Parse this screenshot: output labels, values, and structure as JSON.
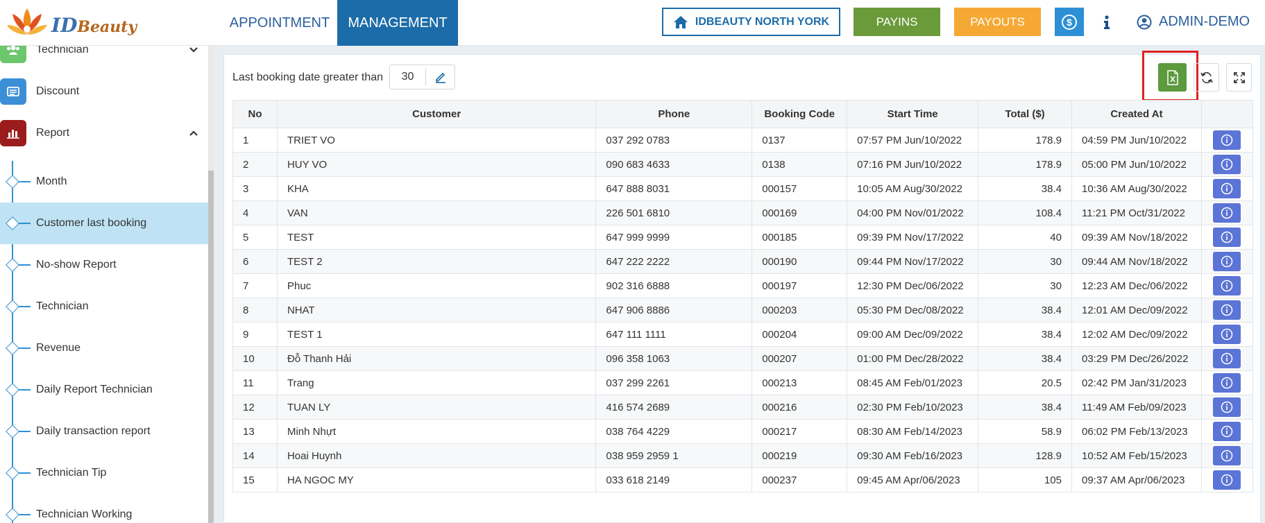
{
  "header": {
    "logo_id": "ID",
    "logo_text": "Beauty",
    "tabs": [
      {
        "label": "APPOINTMENT",
        "active": false
      },
      {
        "label": "MANAGEMENT",
        "active": true
      }
    ],
    "store_label": "IDBEAUTY NORTH YORK",
    "payins_label": "PAYINS",
    "payouts_label": "PAYOUTS",
    "user_label": "ADMIN-DEMO",
    "colors": {
      "brand": "#1b6ca8",
      "payins": "#6a9a3a",
      "payouts": "#f5a833",
      "dollar": "#2d8fd5"
    }
  },
  "sidebar": {
    "menu": [
      {
        "label": "Technician",
        "icon": "users-icon",
        "color": "#6cc66c",
        "expanded": false
      },
      {
        "label": "Discount",
        "icon": "discount-icon",
        "color": "#3c8fd6",
        "expanded": false
      },
      {
        "label": "Report",
        "icon": "bar-chart-icon",
        "color": "#9b1c1c",
        "expanded": true
      }
    ],
    "sub_items": [
      {
        "label": "Month",
        "active": false
      },
      {
        "label": "Customer last booking",
        "active": true
      },
      {
        "label": "No-show Report",
        "active": false
      },
      {
        "label": "Technician",
        "active": false
      },
      {
        "label": "Revenue",
        "active": false
      },
      {
        "label": "Daily Report Technician",
        "active": false
      },
      {
        "label": "Daily transaction report",
        "active": false
      },
      {
        "label": "Technician Tip",
        "active": false
      },
      {
        "label": "Technician Working",
        "active": false
      }
    ]
  },
  "filter": {
    "label": "Last booking date greater than",
    "value": "30"
  },
  "table": {
    "columns": [
      "No",
      "Customer",
      "Phone",
      "Booking Code",
      "Start Time",
      "Total ($)",
      "Created At",
      ""
    ],
    "rows": [
      [
        "1",
        "TRIET VO",
        "037 292 0783",
        "0137",
        "07:57 PM Jun/10/2022",
        "178.9",
        "04:59 PM Jun/10/2022"
      ],
      [
        "2",
        "HUY VO",
        "090 683 4633",
        "0138",
        "07:16 PM Jun/10/2022",
        "178.9",
        "05:00 PM Jun/10/2022"
      ],
      [
        "3",
        "KHA",
        "647 888 8031",
        "000157",
        "10:05 AM Aug/30/2022",
        "38.4",
        "10:36 AM Aug/30/2022"
      ],
      [
        "4",
        "VAN",
        "226 501 6810",
        "000169",
        "04:00 PM Nov/01/2022",
        "108.4",
        "11:21 PM Oct/31/2022"
      ],
      [
        "5",
        "TEST",
        "647 999 9999",
        "000185",
        "09:39 PM Nov/17/2022",
        "40",
        "09:39 AM Nov/18/2022"
      ],
      [
        "6",
        "TEST 2",
        "647 222 2222",
        "000190",
        "09:44 PM Nov/17/2022",
        "30",
        "09:44 AM Nov/18/2022"
      ],
      [
        "7",
        "Phuc",
        "902 316 6888",
        "000197",
        "12:30 PM Dec/06/2022",
        "30",
        "12:23 AM Dec/06/2022"
      ],
      [
        "8",
        "NHAT",
        "647 906 8886",
        "000203",
        "05:30 PM Dec/08/2022",
        "38.4",
        "12:01 AM Dec/09/2022"
      ],
      [
        "9",
        "TEST 1",
        "647 111 1111",
        "000204",
        "09:00 AM Dec/09/2022",
        "38.4",
        "12:02 AM Dec/09/2022"
      ],
      [
        "10",
        "Đỗ Thanh Hải",
        "096 358 1063",
        "000207",
        "01:00 PM Dec/28/2022",
        "38.4",
        "03:29 PM Dec/26/2022"
      ],
      [
        "11",
        "Trang",
        "037 299 2261",
        "000213",
        "08:45 AM Feb/01/2023",
        "20.5",
        "02:42 PM Jan/31/2023"
      ],
      [
        "12",
        "TUAN LY",
        "416 574 2689",
        "000216",
        "02:30 PM Feb/10/2023",
        "38.4",
        "11:49 AM Feb/09/2023"
      ],
      [
        "13",
        "Minh Nhựt",
        "038 764 4229",
        "000217",
        "08:30 AM Feb/14/2023",
        "58.9",
        "06:02 PM Feb/13/2023"
      ],
      [
        "14",
        "Hoai Huynh",
        "038 959 2959 1",
        "000219",
        "09:30 AM Feb/16/2023",
        "128.9",
        "10:52 AM Feb/15/2023"
      ],
      [
        "15",
        "HA NGOC MY",
        "033 618 2149",
        "000237",
        "09:45 AM Apr/06/2023",
        "105",
        "09:37 AM Apr/06/2023"
      ]
    ]
  }
}
